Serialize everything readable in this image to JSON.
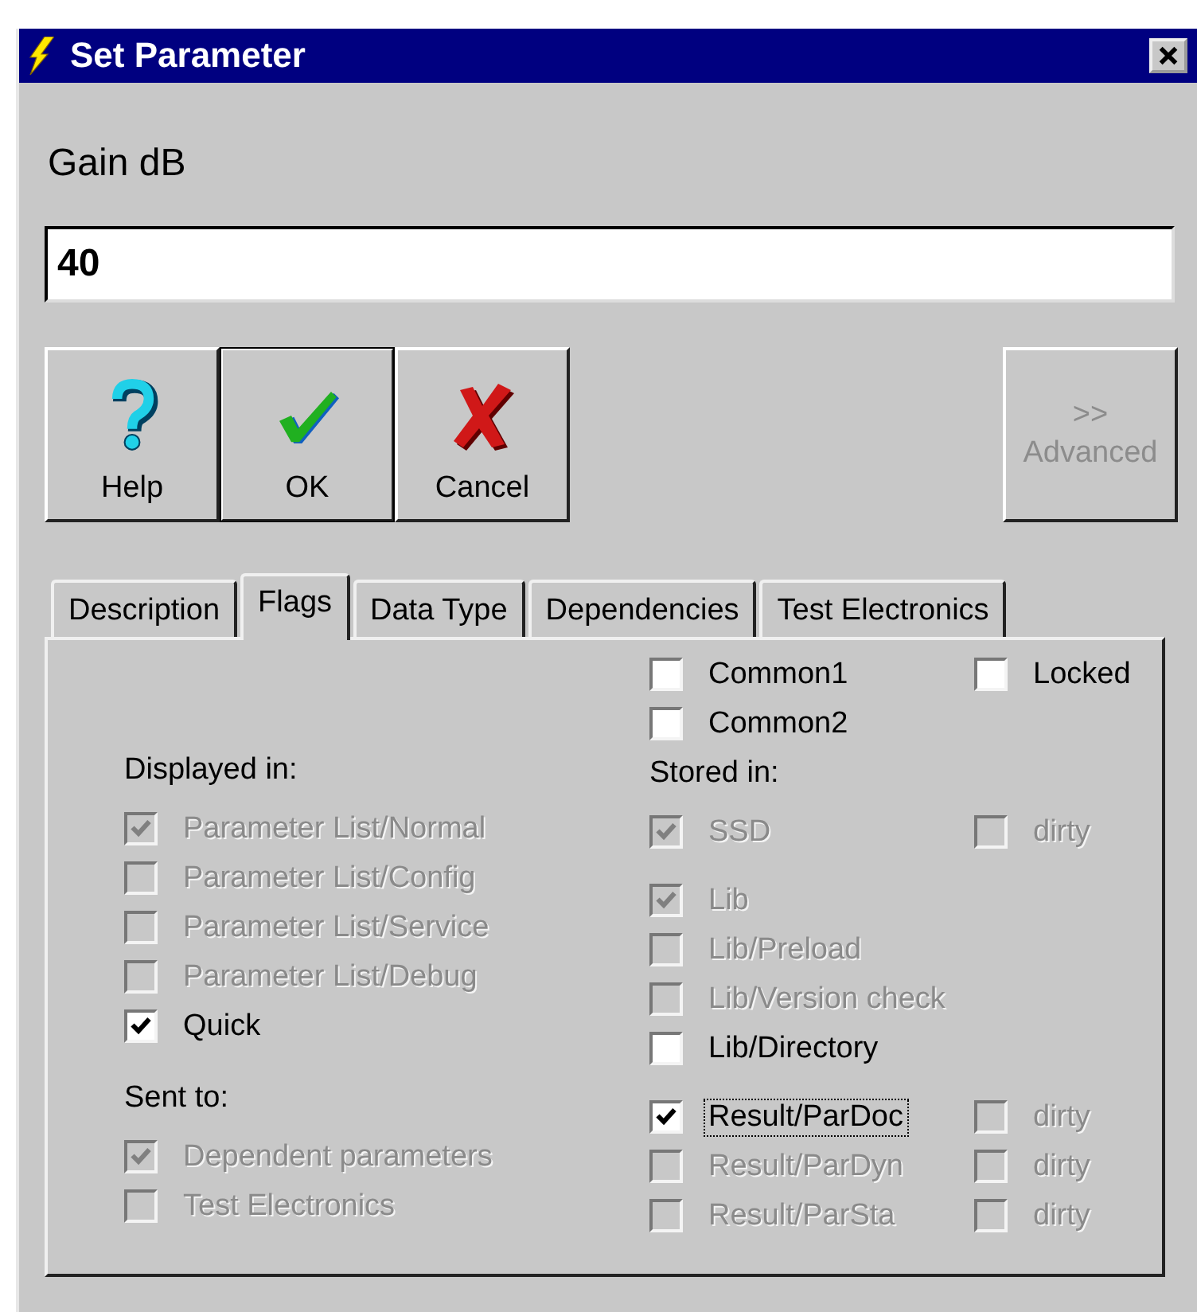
{
  "window": {
    "title": "Set Parameter"
  },
  "parameter": {
    "label": "Gain dB",
    "value": "40"
  },
  "buttons": [
    {
      "kind": "help",
      "label": "Help",
      "default": false
    },
    {
      "kind": "ok",
      "label": "OK",
      "default": true
    },
    {
      "kind": "cancel",
      "label": "Cancel",
      "default": false
    }
  ],
  "advanced_button": {
    "label_lines": [
      ">>",
      "Advanced"
    ],
    "disabled": true
  },
  "tabs": [
    {
      "label": "Description",
      "selected": false
    },
    {
      "label": "Flags",
      "selected": true
    },
    {
      "label": "Data Type",
      "selected": false
    },
    {
      "label": "Dependencies",
      "selected": false
    },
    {
      "label": "Test Electronics",
      "selected": false
    }
  ],
  "left_sections": [
    {
      "heading": "Displayed in:",
      "items": [
        {
          "label": "Parameter List/Normal",
          "checked": true,
          "disabled": true
        },
        {
          "label": "Parameter List/Config",
          "checked": false,
          "disabled": true
        },
        {
          "label": "Parameter List/Service",
          "checked": false,
          "disabled": true
        },
        {
          "label": "Parameter List/Debug",
          "checked": false,
          "disabled": true
        },
        {
          "label": "Quick",
          "checked": true,
          "disabled": false
        }
      ]
    },
    {
      "heading": "Sent to:",
      "items": [
        {
          "label": "Dependent parameters",
          "checked": true,
          "disabled": true
        },
        {
          "label": "Test Electronics",
          "checked": false,
          "disabled": true
        }
      ]
    }
  ],
  "right_sections": [
    {
      "rows": [
        {
          "main": {
            "label": "Common1",
            "checked": false,
            "disabled": false,
            "focused": false
          },
          "side": {
            "label": "Locked",
            "checked": false,
            "disabled": false
          }
        },
        {
          "main": {
            "label": "Common2",
            "checked": false,
            "disabled": false,
            "focused": false
          }
        }
      ]
    },
    {
      "heading": "Stored in:",
      "rows": [
        {
          "main": {
            "label": "SSD",
            "checked": true,
            "disabled": true,
            "focused": false
          },
          "side": {
            "label": "dirty",
            "checked": false,
            "disabled": true
          }
        }
      ]
    },
    {
      "rows": [
        {
          "main": {
            "label": "Lib",
            "checked": true,
            "disabled": true,
            "focused": false
          }
        },
        {
          "main": {
            "label": "Lib/Preload",
            "checked": false,
            "disabled": true,
            "focused": false
          }
        },
        {
          "main": {
            "label": "Lib/Version check",
            "checked": false,
            "disabled": true,
            "focused": false
          }
        },
        {
          "main": {
            "label": "Lib/Directory",
            "checked": false,
            "disabled": false,
            "focused": false
          }
        }
      ]
    },
    {
      "rows": [
        {
          "main": {
            "label": "Result/ParDoc",
            "checked": true,
            "disabled": false,
            "focused": true
          },
          "side": {
            "label": "dirty",
            "checked": false,
            "disabled": true
          }
        },
        {
          "main": {
            "label": "Result/ParDyn",
            "checked": false,
            "disabled": true,
            "focused": false
          },
          "side": {
            "label": "dirty",
            "checked": false,
            "disabled": true
          }
        },
        {
          "main": {
            "label": "Result/ParSta",
            "checked": false,
            "disabled": true,
            "focused": false
          },
          "side": {
            "label": "dirty",
            "checked": false,
            "disabled": true
          }
        }
      ]
    }
  ]
}
